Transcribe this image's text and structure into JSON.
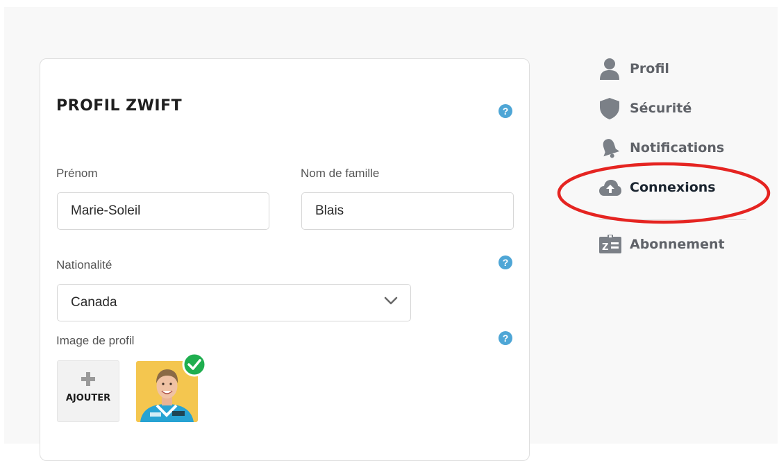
{
  "card": {
    "title": "PROFIL ZWIFT",
    "first_name": {
      "label": "Prénom",
      "value": "Marie-Soleil"
    },
    "last_name": {
      "label": "Nom de famille",
      "value": "Blais"
    },
    "nationality": {
      "label": "Nationalité",
      "value": "Canada"
    },
    "profile_image": {
      "label": "Image de profil",
      "add_label": "AJOUTER"
    },
    "help_glyph": "?"
  },
  "nav": {
    "items": [
      {
        "label": "Profil",
        "icon": "user-icon"
      },
      {
        "label": "Sécurité",
        "icon": "shield-icon"
      },
      {
        "label": "Notifications",
        "icon": "bell-icon"
      },
      {
        "label": "Connexions",
        "icon": "cloud-upload-icon",
        "active": true
      },
      {
        "label": "Abonnement",
        "icon": "id-card-icon"
      }
    ]
  },
  "colors": {
    "help": "#4ea6d6",
    "nav_icon": "#7b8087",
    "nav_active": "#1b2530",
    "highlight_circle": "#e52421",
    "check": "#1fae4f"
  }
}
